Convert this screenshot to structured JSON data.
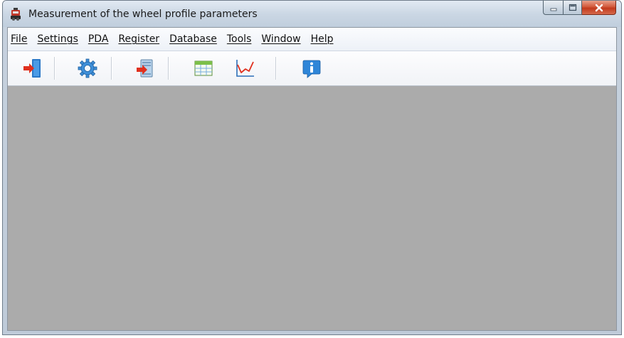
{
  "window": {
    "title": "Measurement of the wheel profile parameters",
    "icon": "app-icon",
    "caption_buttons": [
      "minimize",
      "maximize",
      "close"
    ]
  },
  "menu": {
    "items": [
      {
        "id": "file",
        "label": "File"
      },
      {
        "id": "settings",
        "label": "Settings"
      },
      {
        "id": "pda",
        "label": "PDA"
      },
      {
        "id": "register",
        "label": "Register"
      },
      {
        "id": "database",
        "label": "Database"
      },
      {
        "id": "tools",
        "label": "Tools"
      },
      {
        "id": "window",
        "label": "Window"
      },
      {
        "id": "help",
        "label": "Help"
      }
    ]
  },
  "toolbar": {
    "buttons": [
      {
        "name": "exit-door-icon"
      },
      {
        "name": "settings-gear-icon"
      },
      {
        "name": "import-document-icon"
      },
      {
        "name": "table-grid-icon"
      },
      {
        "name": "line-chart-icon"
      },
      {
        "name": "info-icon"
      }
    ]
  },
  "colors": {
    "mdi_background": "#ababab",
    "close_button": "#c23a1c",
    "title_bar": "#c6d1de"
  }
}
